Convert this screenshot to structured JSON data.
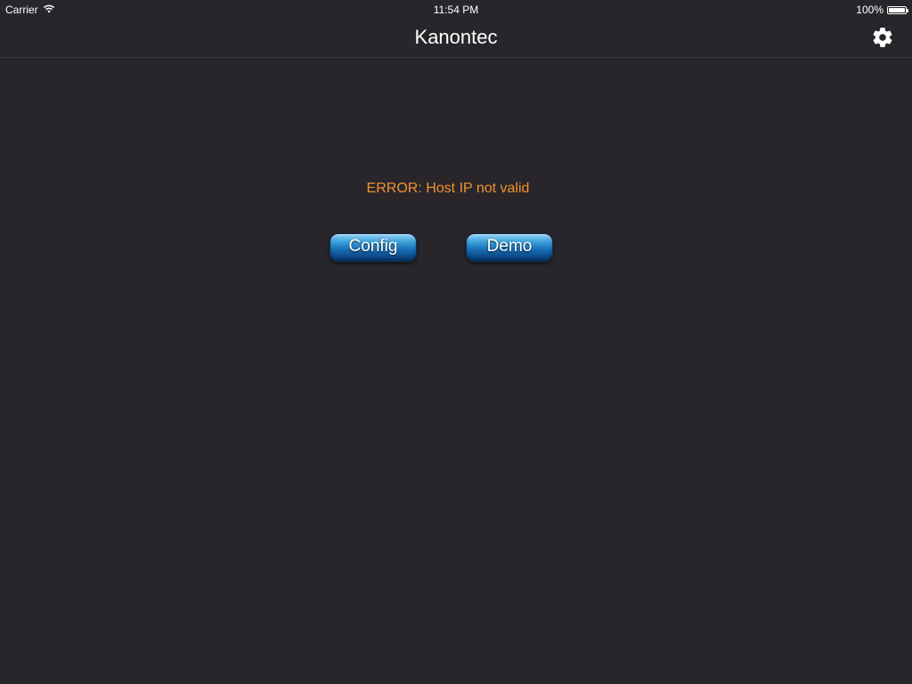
{
  "status_bar": {
    "carrier": "Carrier",
    "time": "11:54 PM",
    "battery_percent": "100%",
    "battery_level": 1.0
  },
  "nav": {
    "title": "Kanontec",
    "settings_icon": "gear-icon"
  },
  "content": {
    "error_message": "ERROR: Host IP not valid",
    "config_label": "Config",
    "demo_label": "Demo"
  },
  "colors": {
    "background": "#29262b",
    "error_text": "#f0922e",
    "button_blue": "#1a72b8"
  }
}
